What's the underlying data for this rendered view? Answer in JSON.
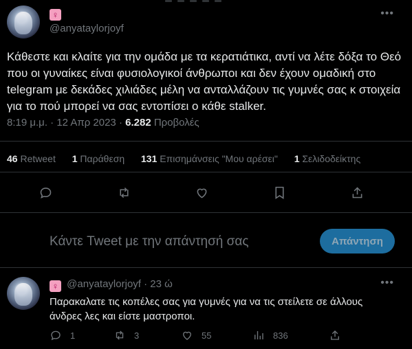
{
  "main_tweet": {
    "display_name_emoji": "♀",
    "handle": "@anyataylorjoyf",
    "text": "Κάθεστε και κλαίτε για την ομάδα με τα κερατιάτικα, αντί να λέτε δόξα το Θεό που οι γυναίκες είναι φυσιολογικοί άνθρωποι και δεν έχουν ομαδική στο telegram με δεκάδες χιλιάδες μέλη να ανταλλάζουν τις γυμνές σας κ στοιχεία για το πού μπορεί να σας εντοπίσει ο κάθε stalker.",
    "time": "8:19 μ.μ.",
    "separator": "·",
    "date": "12 Απρ 2023",
    "views_count": "6.282",
    "views_label": "Προβολές",
    "stats": {
      "retweets_count": "46",
      "retweets_label": "Retweet",
      "quotes_count": "1",
      "quotes_label": "Παράθεση",
      "likes_count": "131",
      "likes_label": "Επισημάνσεις \"Μου αρέσει\"",
      "bookmarks_count": "1",
      "bookmarks_label": "Σελιδοδείκτης"
    }
  },
  "reply_box": {
    "placeholder": "Κάντε Tweet με την απάντησή σας",
    "button_label": "Απάντηση"
  },
  "reply_tweet": {
    "display_name_emoji": "♀",
    "handle": "@anyataylorjoyf",
    "separator": "·",
    "time_ago": "23 ώ",
    "text": "Παρακαλατε τις κοπέλες σας για γυμνές για να τις στείλετε σε άλλους άνδρες λες και είστε μαστροποι.",
    "replies": "1",
    "retweets": "3",
    "likes": "55",
    "views": "836"
  }
}
